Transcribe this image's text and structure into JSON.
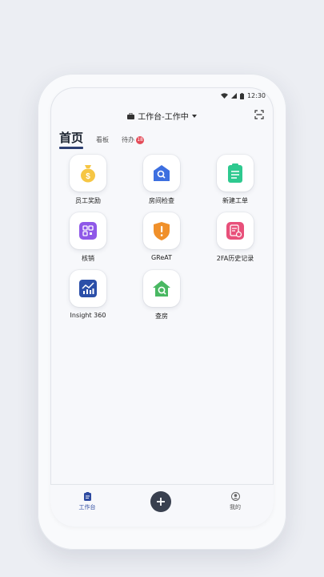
{
  "status_bar": {
    "time": "12:30"
  },
  "header": {
    "title": "工作台-工作中"
  },
  "tabs": [
    {
      "label": "首页"
    },
    {
      "label": "看板"
    },
    {
      "label": "待办",
      "badge": "18"
    }
  ],
  "apps": [
    {
      "label": "员工奖励",
      "icon": "money-bag-icon",
      "color": "#f6c644"
    },
    {
      "label": "房间检查",
      "icon": "house-search-icon",
      "color": "#3d6fe0"
    },
    {
      "label": "新建工单",
      "icon": "clipboard-icon",
      "color": "#2ec98f"
    },
    {
      "label": "核销",
      "icon": "qr-grid-icon",
      "color": "#8f58e8"
    },
    {
      "label": "GReAT",
      "icon": "shield-alert-icon",
      "color": "#f0902a"
    },
    {
      "label": "2FA历史记录",
      "icon": "document-history-icon",
      "color": "#e8507a"
    },
    {
      "label": "Insight 360",
      "icon": "chart-icon",
      "color": "#2b4fa8"
    },
    {
      "label": "查房",
      "icon": "house-check-icon",
      "color": "#49b862"
    }
  ],
  "bottom_nav": {
    "workbench_label": "工作台",
    "mine_label": "我的",
    "active_color": "#2d4aa0"
  }
}
